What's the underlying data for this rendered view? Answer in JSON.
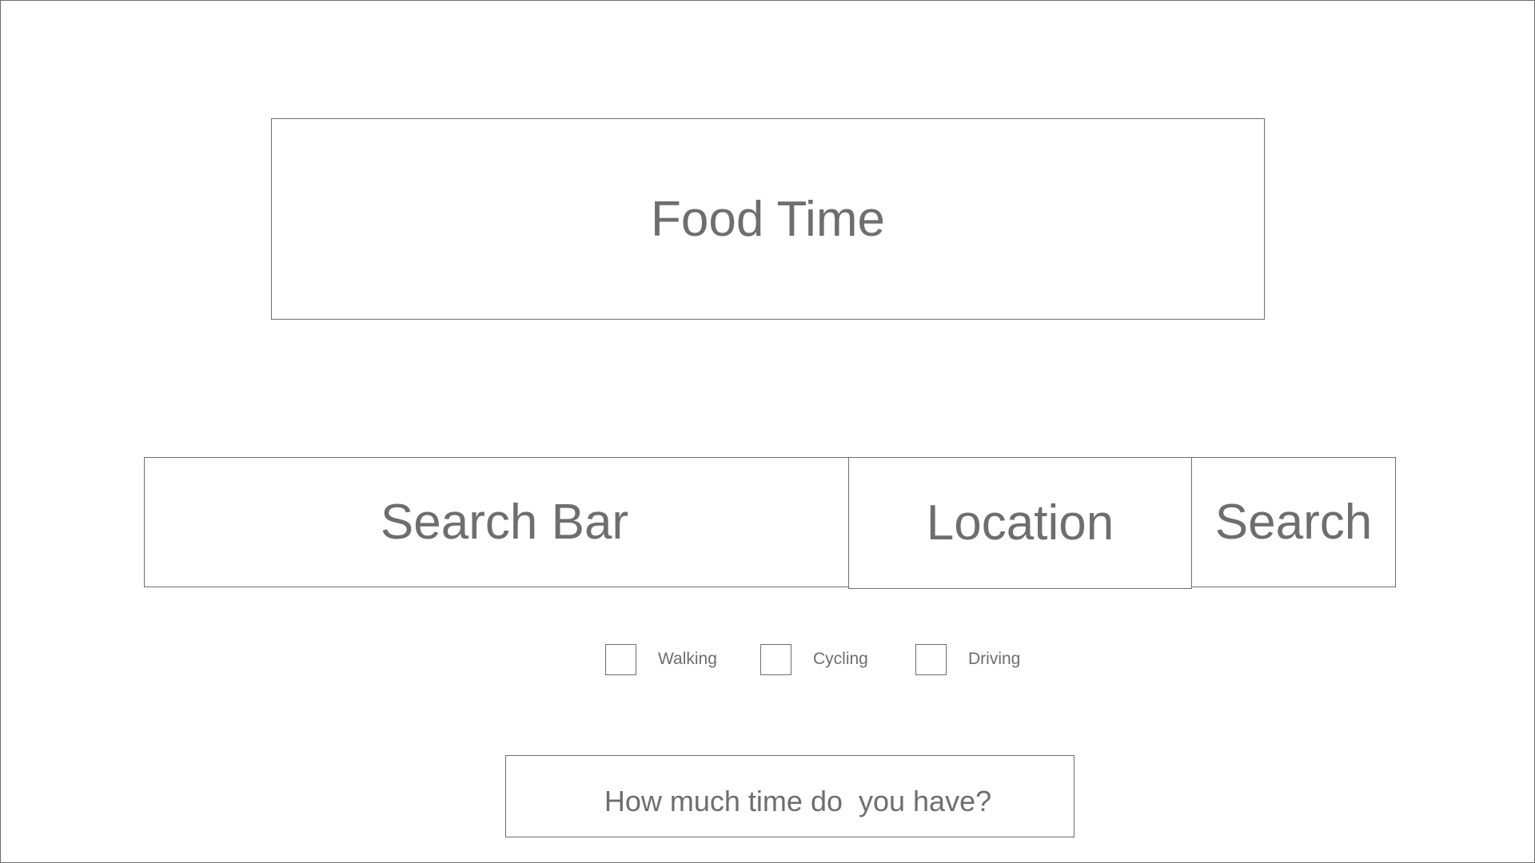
{
  "app": {
    "title": "Food Time"
  },
  "search": {
    "search_bar_label": "Search Bar",
    "location_label": "Location",
    "search_button_label": "Search"
  },
  "travel_modes": {
    "items": [
      {
        "label": "Walking",
        "checked": false
      },
      {
        "label": "Cycling",
        "checked": false
      },
      {
        "label": "Driving",
        "checked": false
      }
    ]
  },
  "time": {
    "prompt": "How much time do  you have?"
  },
  "colors": {
    "stroke": "#6e6e6e",
    "text": "#6e6e6e",
    "background": "#ffffff"
  }
}
